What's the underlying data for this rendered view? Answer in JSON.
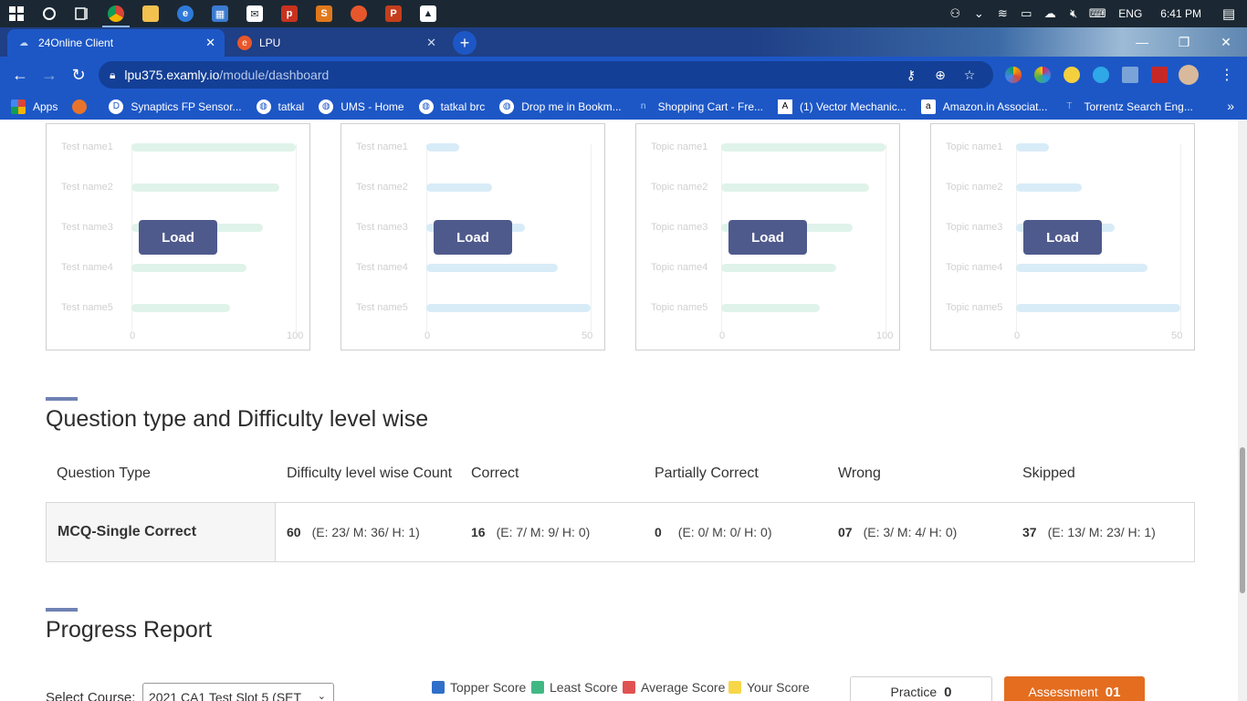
{
  "taskbar": {
    "tray_lang": "ENG",
    "time": "6:41 PM"
  },
  "browser": {
    "tabs": [
      {
        "label": "24Online Client",
        "active": true
      },
      {
        "label": "LPU",
        "active": false
      }
    ],
    "url_host": "lpu375.examly.io",
    "url_path": "/module/dashboard"
  },
  "bookmarks": [
    "Apps",
    "Synaptics FP Sensor...",
    "tatkal",
    "UMS - Home",
    "tatkal brc",
    "Drop me in Bookm...",
    "Shopping Cart - Fre...",
    "(1) Vector Mechanic...",
    "Amazon.in Associat...",
    "Torrentz Search Eng..."
  ],
  "cards": [
    {
      "labels": [
        "Test name1",
        "Test name2",
        "Test name3",
        "Test name4",
        "Test name5"
      ],
      "ticks": [
        "0",
        "100"
      ],
      "color": "green",
      "values": [
        100,
        90,
        80,
        70,
        60
      ],
      "max": 100,
      "load": "Load"
    },
    {
      "labels": [
        "Test name1",
        "Test name2",
        "Test name3",
        "Test name4",
        "Test name5"
      ],
      "ticks": [
        "0",
        "50"
      ],
      "color": "blue",
      "values": [
        10,
        20,
        30,
        40,
        50
      ],
      "max": 50,
      "load": "Load"
    },
    {
      "labels": [
        "Topic name1",
        "Topic name2",
        "Topic name3",
        "Topic name4",
        "Topic name5"
      ],
      "ticks": [
        "0",
        "100"
      ],
      "color": "green",
      "values": [
        100,
        90,
        80,
        70,
        60
      ],
      "max": 100,
      "load": "Load"
    },
    {
      "labels": [
        "Topic name1",
        "Topic name2",
        "Topic name3",
        "Topic name4",
        "Topic name5"
      ],
      "ticks": [
        "0",
        "50"
      ],
      "color": "blue",
      "values": [
        10,
        20,
        30,
        40,
        50
      ],
      "max": 50,
      "load": "Load"
    }
  ],
  "section_question": {
    "title": "Question type and Difficulty level wise",
    "headers": [
      "Question Type",
      "Difficulty level wise Count",
      "Correct",
      "Partially Correct",
      "Wrong",
      "Skipped"
    ],
    "row": {
      "type": "MCQ-Single Correct",
      "cells": [
        {
          "count": "60",
          "detail": "(E: 23/ M: 36/ H: 1)"
        },
        {
          "count": "16",
          "detail": "(E: 7/ M: 9/ H: 0)"
        },
        {
          "count": "0",
          "detail": "(E: 0/ M: 0/ H: 0)"
        },
        {
          "count": "07",
          "detail": "(E: 3/ M: 4/ H: 0)"
        },
        {
          "count": "37",
          "detail": "(E: 13/ M: 23/ H: 1)"
        }
      ]
    }
  },
  "section_progress": {
    "title": "Progress Report",
    "select_label": "Select Course:",
    "select_value": "2021 CA1 Test Slot 5 (SET",
    "legend": [
      {
        "label": "Topper Score",
        "color": "#2f6fc9"
      },
      {
        "label": "Least Score",
        "color": "#41b883"
      },
      {
        "label": "Average Score",
        "color": "#e05252"
      },
      {
        "label": "Your Score",
        "color": "#f7d64a"
      }
    ],
    "practice_label": "Practice",
    "practice_count": "0",
    "assessment_label": "Assessment",
    "assessment_count": "01"
  }
}
